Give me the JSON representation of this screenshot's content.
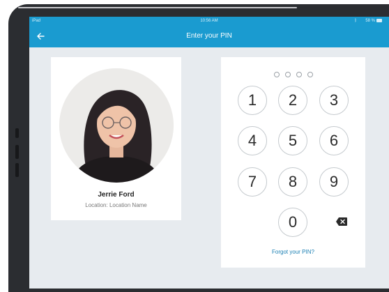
{
  "status_bar": {
    "left": "iPad",
    "time": "10:56 AM",
    "battery": "58 %"
  },
  "nav": {
    "title": "Enter your PIN"
  },
  "profile": {
    "name": "Jerrie Ford",
    "location": "Location: Location Name"
  },
  "keypad": {
    "keys": [
      "1",
      "2",
      "3",
      "4",
      "5",
      "6",
      "7",
      "8",
      "9",
      "0"
    ],
    "pin_length": 4,
    "forgot_label": "Forgot your PIN?"
  },
  "colors": {
    "accent": "#1a9bd0",
    "link": "#1a7fb3",
    "background": "#e7ebef"
  },
  "icons": {
    "back": "arrow-left-icon",
    "delete": "backspace-icon"
  }
}
